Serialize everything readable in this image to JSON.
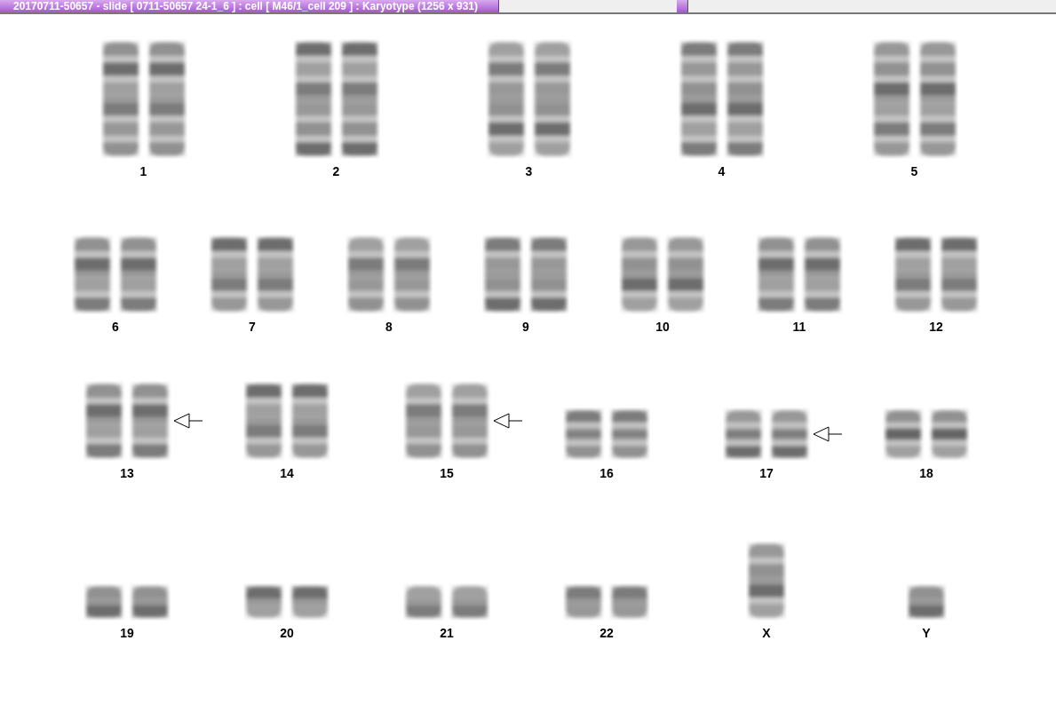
{
  "window": {
    "title": "20170711-50657 - slide [ 0711-50657 24-1_6 ] : cell [ M46/1_cell 209 ] : Karyotype  (1256 x 931)"
  },
  "karyotype": {
    "rows": [
      {
        "groups": [
          {
            "label": "1",
            "kind": "large",
            "pair": true,
            "marked": false
          },
          {
            "label": "2",
            "kind": "large",
            "pair": true,
            "marked": false
          },
          {
            "label": "3",
            "kind": "large",
            "pair": true,
            "marked": false
          },
          {
            "label": "4",
            "kind": "large",
            "pair": true,
            "marked": false
          },
          {
            "label": "5",
            "kind": "large",
            "pair": true,
            "marked": false
          }
        ]
      },
      {
        "groups": [
          {
            "label": "6",
            "kind": "medium",
            "pair": true,
            "marked": false
          },
          {
            "label": "7",
            "kind": "medium",
            "pair": true,
            "marked": false
          },
          {
            "label": "8",
            "kind": "medium",
            "pair": true,
            "marked": false
          },
          {
            "label": "9",
            "kind": "medium",
            "pair": true,
            "marked": false
          },
          {
            "label": "10",
            "kind": "medium",
            "pair": true,
            "marked": false
          },
          {
            "label": "11",
            "kind": "medium",
            "pair": true,
            "marked": false
          },
          {
            "label": "12",
            "kind": "medium",
            "pair": true,
            "marked": false
          }
        ]
      },
      {
        "groups": [
          {
            "label": "13",
            "kind": "medium",
            "pair": true,
            "marked": true
          },
          {
            "label": "14",
            "kind": "medium",
            "pair": true,
            "marked": false
          },
          {
            "label": "15",
            "kind": "medium",
            "pair": true,
            "marked": true
          },
          {
            "label": "16",
            "kind": "small",
            "pair": true,
            "marked": false
          },
          {
            "label": "17",
            "kind": "small",
            "pair": true,
            "marked": true
          },
          {
            "label": "18",
            "kind": "small",
            "pair": true,
            "marked": false
          }
        ]
      },
      {
        "groups": [
          {
            "label": "19",
            "kind": "tiny",
            "pair": true,
            "marked": false
          },
          {
            "label": "20",
            "kind": "tiny",
            "pair": true,
            "marked": false
          },
          {
            "label": "21",
            "kind": "tiny",
            "pair": true,
            "marked": false
          },
          {
            "label": "22",
            "kind": "tiny",
            "pair": true,
            "marked": false
          },
          {
            "label": "X",
            "kind": "medium",
            "pair": false,
            "marked": false
          },
          {
            "label": "Y",
            "kind": "tiny",
            "pair": false,
            "marked": false
          }
        ]
      }
    ]
  }
}
